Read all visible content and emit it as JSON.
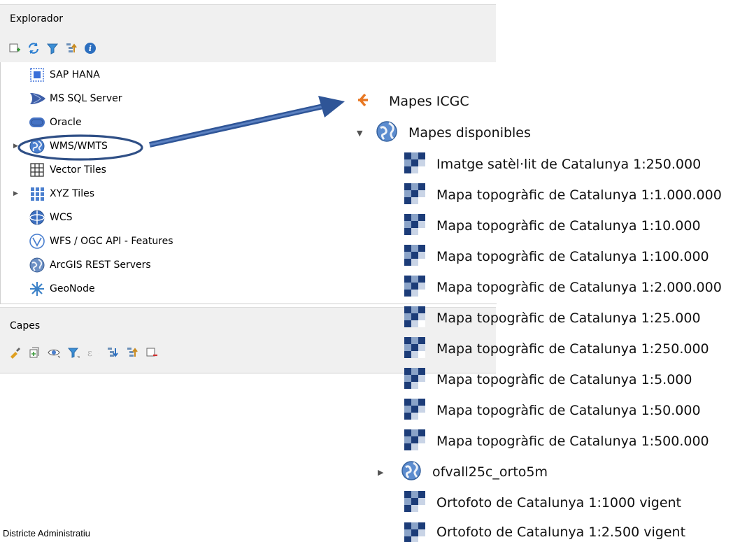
{
  "explorer": {
    "title": "Explorador",
    "toolbar": [
      "add-layer-icon",
      "refresh-icon",
      "filter-icon",
      "collapse-all-icon",
      "info-icon"
    ],
    "items": [
      {
        "label": "SAP HANA",
        "icon": "sap-hana-icon",
        "expandable": false
      },
      {
        "label": "MS SQL Server",
        "icon": "mssql-icon",
        "expandable": false
      },
      {
        "label": "Oracle",
        "icon": "oracle-icon",
        "expandable": false
      },
      {
        "label": "WMS/WMTS",
        "icon": "wms-globe-icon",
        "expandable": true,
        "highlighted": true
      },
      {
        "label": "Vector Tiles",
        "icon": "vector-tiles-icon",
        "expandable": false
      },
      {
        "label": "XYZ Tiles",
        "icon": "xyz-tiles-icon",
        "expandable": true
      },
      {
        "label": "WCS",
        "icon": "wcs-globe-icon",
        "expandable": false
      },
      {
        "label": "WFS / OGC API - Features",
        "icon": "wfs-globe-icon",
        "expandable": false
      },
      {
        "label": "ArcGIS REST Servers",
        "icon": "arcgis-globe-icon",
        "expandable": false
      },
      {
        "label": "GeoNode",
        "icon": "geonode-icon",
        "expandable": false
      }
    ]
  },
  "layers": {
    "title": "Capes",
    "toolbar": [
      "style-brush-icon",
      "add-group-icon",
      "visibility-eye-icon",
      "filter-legend-icon",
      "filter-expression-icon",
      "expand-all-icon",
      "collapse-all-icon",
      "remove-layer-icon"
    ]
  },
  "connection_tree": {
    "root": {
      "label": "Mapes ICGC",
      "icon": "connection-icon"
    },
    "group": {
      "label": "Mapes disponibles",
      "icon": "globe-icon",
      "expanded": true
    },
    "layers": [
      "Imatge satèl·lit de Catalunya 1:250.000",
      "Mapa topogràfic de Catalunya 1:1.000.000",
      "Mapa topogràfic de Catalunya 1:10.000",
      "Mapa topogràfic de Catalunya 1:100.000",
      "Mapa topogràfic de Catalunya 1:2.000.000",
      "Mapa topogràfic de Catalunya 1:25.000",
      "Mapa topogràfic de Catalunya 1:250.000",
      "Mapa topogràfic de Catalunya 1:5.000",
      "Mapa topogràfic de Catalunya 1:50.000",
      "Mapa topogràfic de Catalunya 1:500.000"
    ],
    "subgroup": {
      "label": "ofvall25c_orto5m",
      "icon": "globe-icon",
      "expanded": false
    },
    "extra_layers": [
      "Ortofoto de Catalunya 1:1000 vigent",
      "Ortofoto de Catalunya 1:2.500 vigent"
    ]
  },
  "footer": {
    "text": "Districte Administratiu"
  },
  "colors": {
    "highlight_ellipse": "#2f4f86",
    "arrow": "#2f5597",
    "panel_bg": "#f0f0f0",
    "connection_orange": "#e87722"
  }
}
